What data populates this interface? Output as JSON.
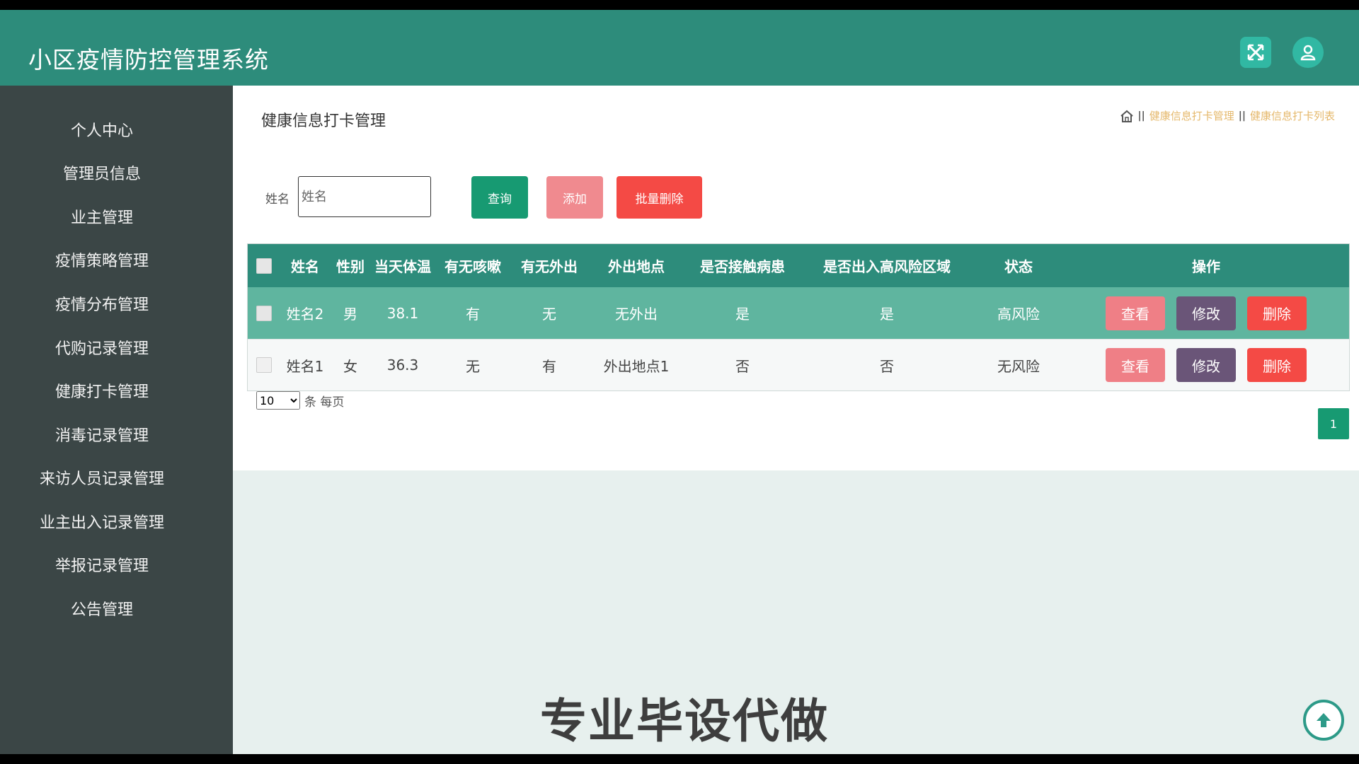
{
  "app": {
    "title": "小区疫情防控管理系统"
  },
  "header_icons": {
    "fullscreen": "fullscreen-icon",
    "user": "user-icon"
  },
  "sidebar": {
    "items": [
      {
        "label": "个人中心"
      },
      {
        "label": "管理员信息"
      },
      {
        "label": "业主管理"
      },
      {
        "label": "疫情策略管理"
      },
      {
        "label": "疫情分布管理"
      },
      {
        "label": "代购记录管理"
      },
      {
        "label": "健康打卡管理"
      },
      {
        "label": "消毒记录管理"
      },
      {
        "label": "来访人员记录管理"
      },
      {
        "label": "业主出入记录管理"
      },
      {
        "label": "举报记录管理"
      },
      {
        "label": "公告管理"
      }
    ]
  },
  "page": {
    "title": "健康信息打卡管理",
    "breadcrumb": {
      "home_icon": "home-icon",
      "separator": "||",
      "level1": "健康信息打卡管理",
      "level2": "健康信息打卡列表"
    }
  },
  "search": {
    "label": "姓名",
    "placeholder": "姓名",
    "value": ""
  },
  "toolbar": {
    "query": "查询",
    "add": "添加",
    "batch_delete": "批量删除"
  },
  "table": {
    "columns": [
      "姓名",
      "性别",
      "当天体温",
      "有无咳嗽",
      "有无外出",
      "外出地点",
      "是否接触病患",
      "是否出入高风险区域",
      "状态",
      "操作"
    ],
    "rows": [
      {
        "name": "姓名2",
        "gender": "男",
        "temperature": "38.1",
        "cough": "有",
        "went_out": "无",
        "location": "无外出",
        "contact": "是",
        "high_risk_area": "是",
        "status": "高风险"
      },
      {
        "name": "姓名1",
        "gender": "女",
        "temperature": "36.3",
        "cough": "无",
        "went_out": "有",
        "location": "外出地点1",
        "contact": "否",
        "high_risk_area": "否",
        "status": "无风险"
      }
    ],
    "actions": {
      "view": "查看",
      "edit": "修改",
      "delete": "删除"
    }
  },
  "pagination": {
    "page_size": "10",
    "page_size_options": [
      "10"
    ],
    "per_page_label": "条 每页",
    "current_page": "1"
  },
  "watermark": "专业毕设代做",
  "colors": {
    "header": "#2d8c7b",
    "sidebar": "#3b4646",
    "primary_button": "#179a72",
    "danger": "#f44a45",
    "edit": "#6a5578",
    "view": "#ef7f86"
  }
}
